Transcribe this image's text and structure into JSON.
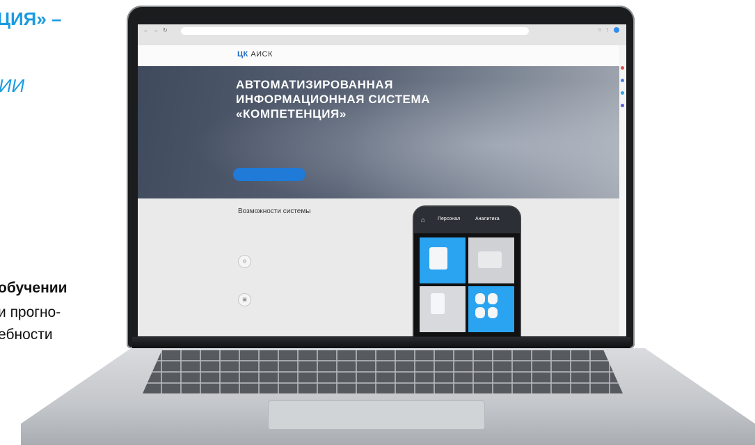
{
  "left_text": {
    "title": "ЦИЯ» –",
    "italic": "ИИ",
    "bold": "обучении",
    "line1": "и прогно-",
    "line2": "ебности"
  },
  "browser": {
    "address": "",
    "bookmarks": [
      "",
      "",
      ""
    ]
  },
  "site": {
    "logo_mark": "ЦК",
    "logo_text": "АИСК",
    "nav": [
      "",
      "",
      "",
      "",
      ""
    ]
  },
  "hero": {
    "headline_1": "АВТОМАТИЗИРОВАННАЯ",
    "headline_2": "ИНФОРМАЦИОННАЯ СИСТЕМА",
    "headline_3": "«КОМПЕТЕНЦИЯ»",
    "description": "",
    "link": "",
    "button": ""
  },
  "features": {
    "title": "Возможности системы",
    "description": "",
    "items": [
      {
        "name": "",
        "text": ""
      },
      {
        "name": "",
        "text": ""
      },
      {
        "name": "",
        "text": ""
      }
    ]
  },
  "phone": {
    "tab_1": "Персонал",
    "tab_2": "Аналитика"
  },
  "colors": {
    "accent": "#1a9be0",
    "button": "#1f7ad8"
  }
}
